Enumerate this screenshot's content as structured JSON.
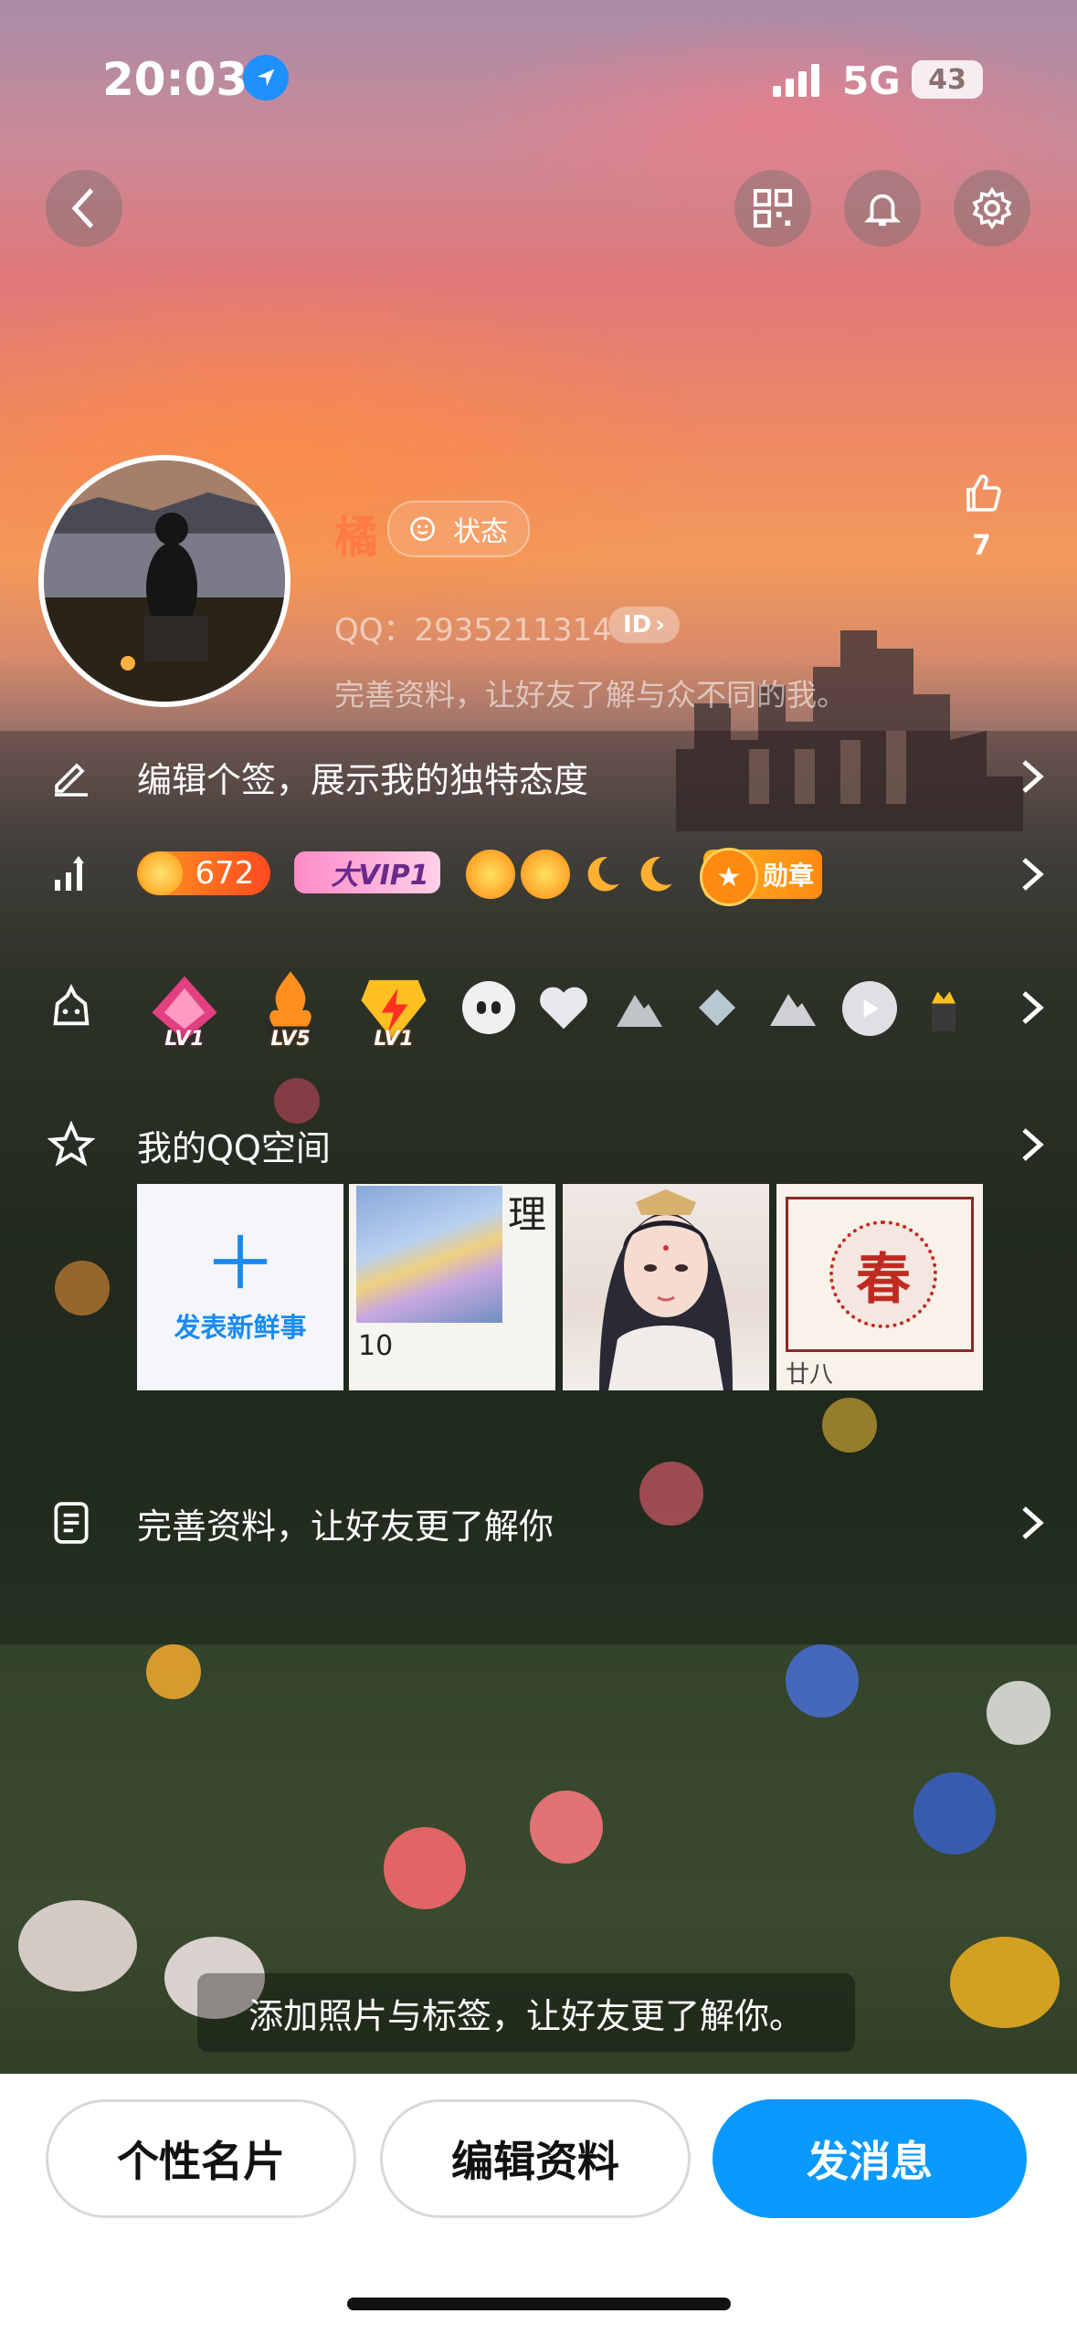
{
  "status_bar": {
    "time": "20:03",
    "network": "5G",
    "battery": "43"
  },
  "profile": {
    "name": "橘",
    "status_label": "状态",
    "qq_label": "QQ：2935211314",
    "id_badge": "ID",
    "complete_hint": "完善资料，让好友了解与众不同的我。",
    "likes": "7"
  },
  "rows": {
    "signature": "编辑个签，展示我的独特态度",
    "coins": "672",
    "vip": "大VIP1",
    "medal": "勋章",
    "qzone_title": "我的QQ空间",
    "post_new": "发表新鲜事",
    "profile_hint": "完善资料，让好友更了解你"
  },
  "game_badges": [
    "LV1",
    "LV5",
    "LV1"
  ],
  "tile2": {
    "char": "理",
    "date": "10"
  },
  "tile4": {
    "char": "春",
    "caption": "廿八"
  },
  "photo_tip": "添加照片与标签，让好友更了解你。",
  "buttons": {
    "card": "个性名片",
    "edit": "编辑资料",
    "message": "发消息"
  },
  "colors": {
    "accent": "#0099ff",
    "name": "#ff7a45"
  }
}
